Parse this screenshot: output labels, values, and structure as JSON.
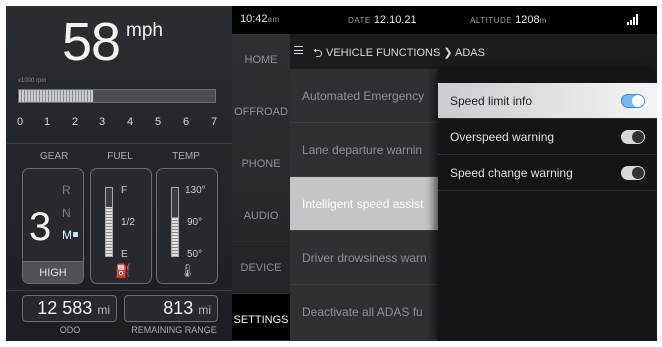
{
  "cluster": {
    "speed": "58",
    "speed_unit": "mph",
    "rpm_scale_label": "x1000 rpm",
    "rpm_fill_fraction": 0.38,
    "rpm_ticks": [
      "0",
      "1",
      "2",
      "3",
      "4",
      "5",
      "6",
      "7"
    ],
    "gear_label": "GEAR",
    "fuel_label": "FUEL",
    "temp_label": "TEMP",
    "gear": "3",
    "gear_options": [
      "R",
      "N",
      "M"
    ],
    "gear_mode": "HIGH",
    "fuel_scale": [
      "F",
      "1/2",
      "E"
    ],
    "fuel_level_fraction": 0.72,
    "temp_scale": [
      "130°",
      "90°",
      "50°"
    ],
    "temp_level_fraction": 0.58,
    "odo_value": "12 583",
    "odo_unit": "mi",
    "odo_label": "ODO",
    "range_value": "813",
    "range_unit": "mi",
    "range_label": "REMAINING RANGE"
  },
  "topbar": {
    "time": "10:42",
    "time_suffix": "am",
    "date_label": "DATE",
    "date_value": "12.10.21",
    "altitude_label": "ALTITUDE",
    "altitude_value": "1208",
    "altitude_unit": "m"
  },
  "nav": [
    "HOME",
    "OFFROAD",
    "PHONE",
    "AUDIO",
    "DEVICE",
    "SETTINGS"
  ],
  "breadcrumb": "VEHICLE FUNCTIONS ❯ ADAS",
  "adas_list": [
    "Automated Emergency",
    "Lane departure warnin",
    "Intelligent speed assist",
    "Driver drowsiness warn",
    "Deactivate all ADAS fu"
  ],
  "popup": [
    {
      "label": "Speed limit info",
      "state": "on"
    },
    {
      "label": "Overspeed warning",
      "state": "off"
    },
    {
      "label": "Speed change warning",
      "state": "off"
    }
  ],
  "colors": {
    "toggle_on": "#76b6f4",
    "highlight": "#c3c6c9"
  }
}
